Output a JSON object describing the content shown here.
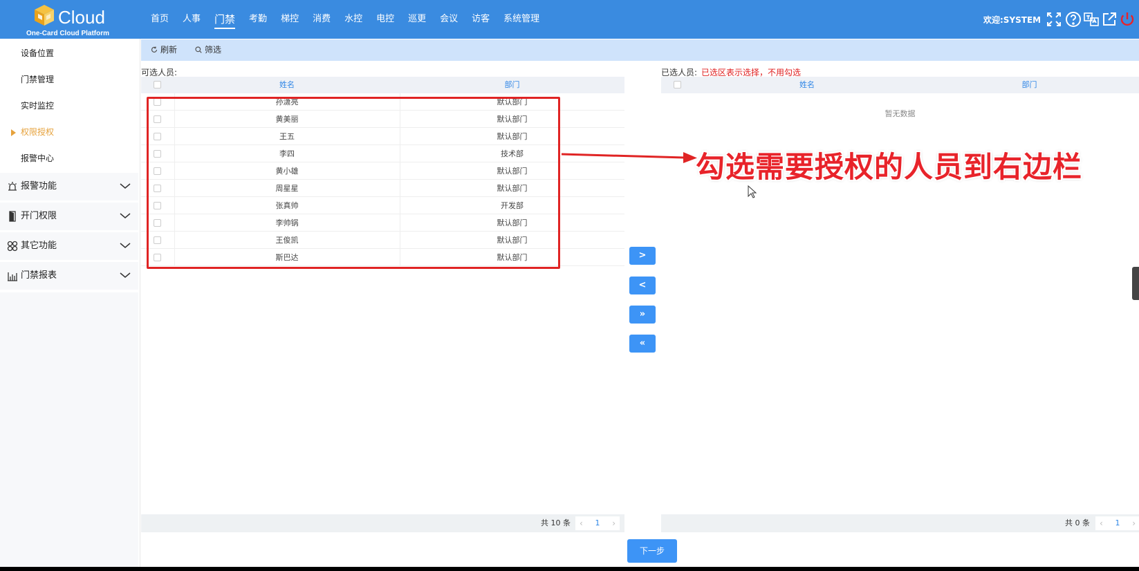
{
  "header": {
    "brand": "Cloud",
    "brand_subtitle": "One-Card Cloud Platform",
    "nav": [
      "首页",
      "人事",
      "门禁",
      "考勤",
      "梯控",
      "消费",
      "水控",
      "电控",
      "巡更",
      "会议",
      "访客",
      "系统管理"
    ],
    "active_nav": "门禁",
    "welcome": "欢迎:SYSTEM",
    "icons": [
      "fullscreen-icon",
      "help-icon",
      "translate-icon",
      "external-link-icon",
      "power-icon"
    ]
  },
  "sidebar": {
    "items": [
      "设备位置",
      "门禁管理",
      "实时监控",
      "权限授权",
      "报警中心"
    ],
    "active_item": "权限授权",
    "groups": [
      {
        "label": "报警功能",
        "icon": "alarm-icon"
      },
      {
        "label": "开门权限",
        "icon": "door-icon"
      },
      {
        "label": "其它功能",
        "icon": "apps-icon"
      },
      {
        "label": "门禁报表",
        "icon": "report-icon"
      }
    ]
  },
  "toolbar": {
    "refresh": "刷新",
    "filter": "筛选"
  },
  "left_panel": {
    "label": "可选人员:",
    "columns": [
      "姓名",
      "部门"
    ],
    "rows": [
      {
        "name": "孙潇亮",
        "dept": "默认部门"
      },
      {
        "name": "黄美丽",
        "dept": "默认部门"
      },
      {
        "name": "王五",
        "dept": "默认部门"
      },
      {
        "name": "李四",
        "dept": "技术部"
      },
      {
        "name": "黄小雄",
        "dept": "默认部门"
      },
      {
        "name": "周星星",
        "dept": "默认部门"
      },
      {
        "name": "张真帅",
        "dept": "开发部"
      },
      {
        "name": "李帅锅",
        "dept": "默认部门"
      },
      {
        "name": "王俊凯",
        "dept": "默认部门"
      },
      {
        "name": "斯巴达",
        "dept": "默认部门"
      }
    ],
    "total": "共 10 条",
    "page": "1"
  },
  "right_panel": {
    "label": "已选人员:",
    "note": "已选区表示选择，不用勾选",
    "columns": [
      "姓名",
      "部门"
    ],
    "empty_text": "暂无数据",
    "total": "共 0 条",
    "page": "1"
  },
  "transfer_buttons": [
    ">",
    "<",
    "»",
    "«"
  ],
  "next_button": "下一步",
  "annotation": "勾选需要授权的人员到右边栏",
  "colors": {
    "header": "#3a8be0",
    "accent": "#3d94f6",
    "active_menu": "#e6a23c",
    "annotation": "#e8232a"
  }
}
